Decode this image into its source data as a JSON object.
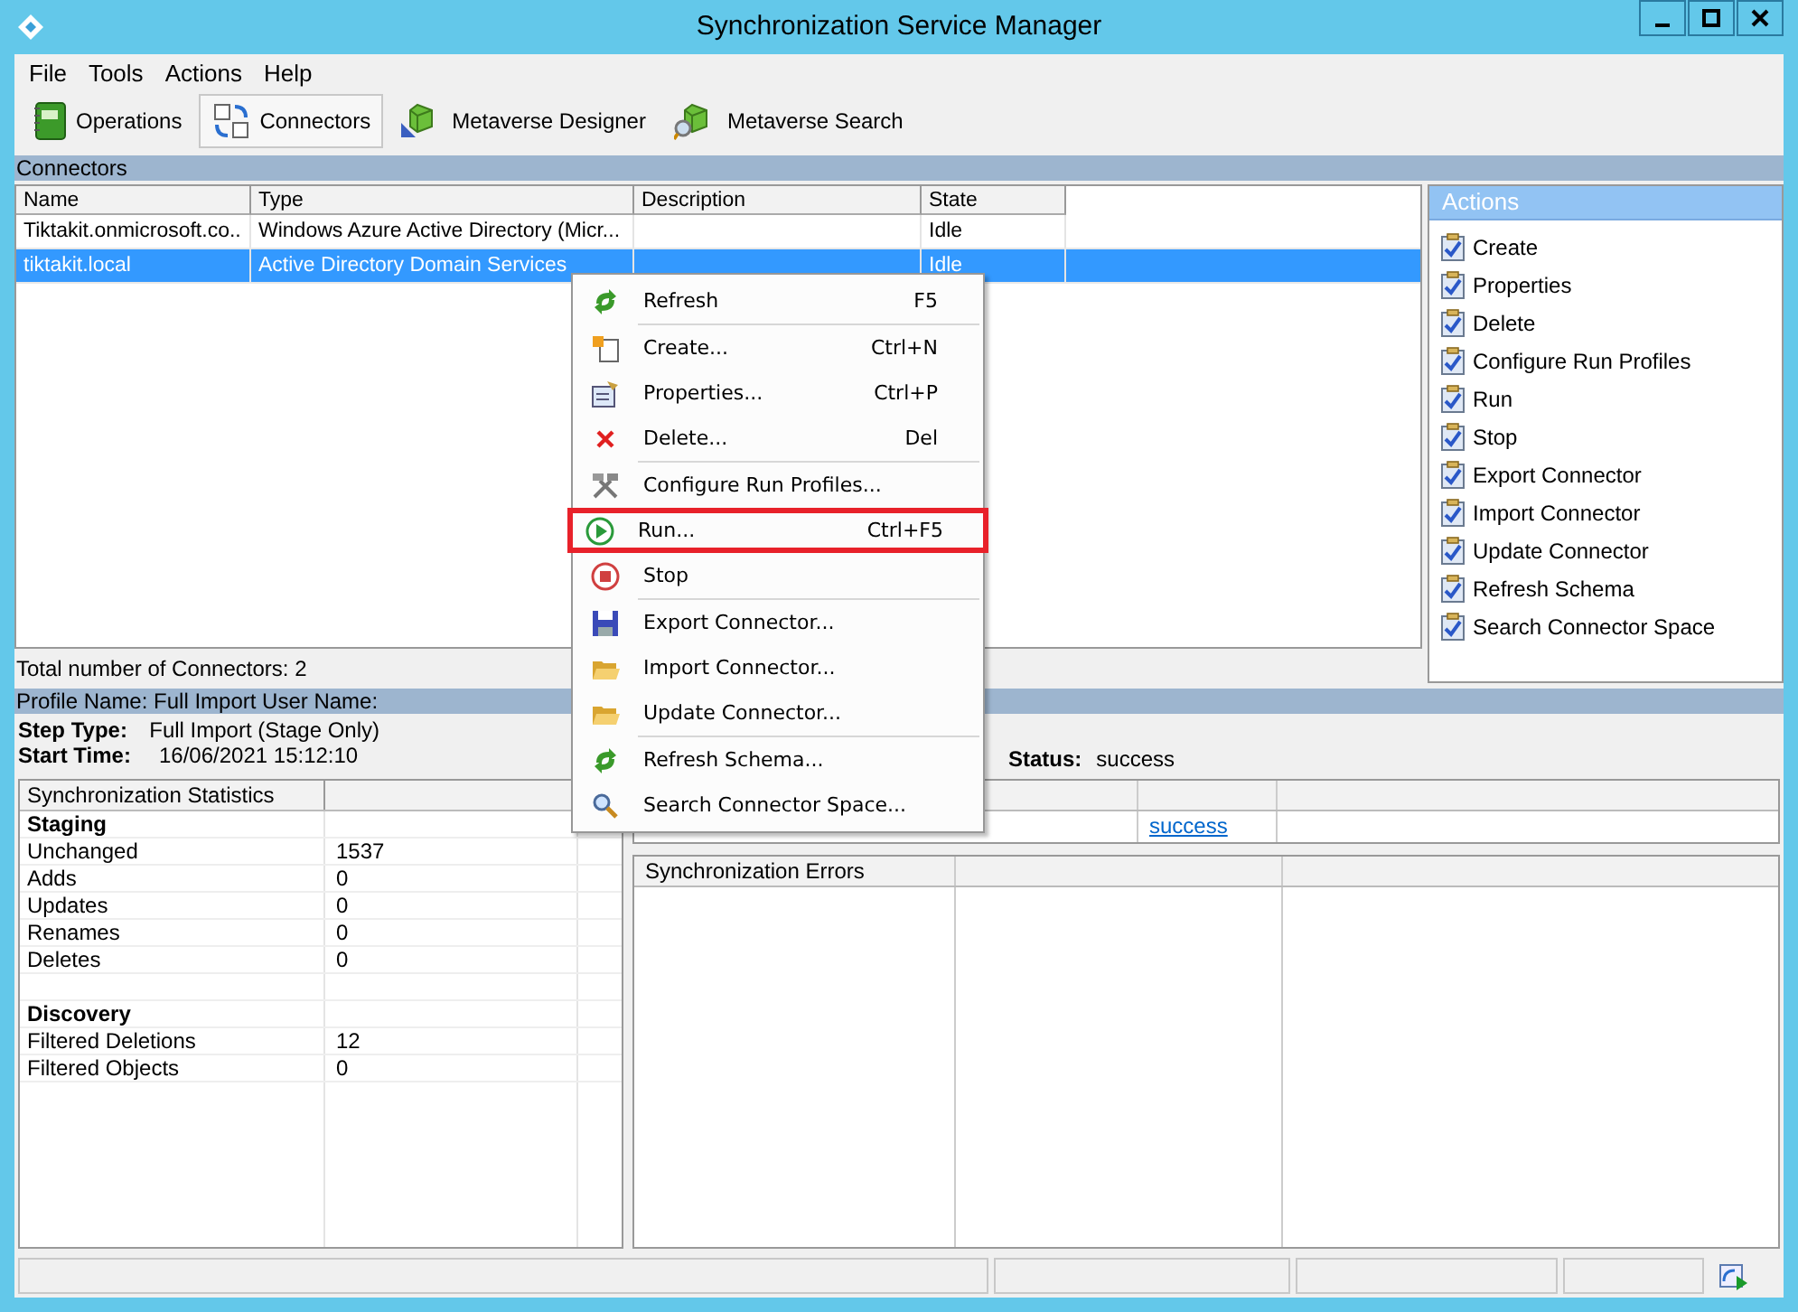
{
  "window": {
    "title": "Synchronization Service Manager"
  },
  "menu_bar": [
    "File",
    "Tools",
    "Actions",
    "Help"
  ],
  "toolbar": [
    {
      "label": "Operations",
      "selected": false
    },
    {
      "label": "Connectors",
      "selected": true
    },
    {
      "label": "Metaverse Designer",
      "selected": false
    },
    {
      "label": "Metaverse Search",
      "selected": false
    }
  ],
  "connectors": {
    "title": "Connectors",
    "columns": [
      "Name",
      "Type",
      "Description",
      "State"
    ],
    "rows": [
      {
        "cells": [
          "Tiktakit.onmicrosoft.co..",
          "Windows Azure Active Directory (Micr...",
          "",
          "Idle"
        ],
        "selected": false
      },
      {
        "cells": [
          "tiktakit.local",
          "Active Directory Domain Services",
          "",
          "Idle"
        ],
        "selected": true
      }
    ],
    "total": "Total number of Connectors: 2"
  },
  "actions": {
    "title": "Actions",
    "items": [
      "Create",
      "Properties",
      "Delete",
      "Configure Run Profiles",
      "Run",
      "Stop",
      "Export Connector",
      "Import Connector",
      "Update Connector",
      "Refresh Schema",
      "Search Connector Space"
    ]
  },
  "context_menu": {
    "groups": [
      [
        {
          "label": "Refresh",
          "shortcut": "F5",
          "highlighted": false
        }
      ],
      [
        {
          "label": "Create...",
          "shortcut": "Ctrl+N",
          "highlighted": false
        },
        {
          "label": "Properties...",
          "shortcut": "Ctrl+P",
          "highlighted": false
        },
        {
          "label": "Delete...",
          "shortcut": "Del",
          "highlighted": false
        }
      ],
      [
        {
          "label": "Configure Run Profiles...",
          "highlighted": false
        },
        {
          "label": "Run...",
          "shortcut": "Ctrl+F5",
          "highlighted": true
        },
        {
          "label": "Stop",
          "highlighted": false
        }
      ],
      [
        {
          "label": "Export Connector...",
          "highlighted": false
        },
        {
          "label": "Import Connector...",
          "highlighted": false
        },
        {
          "label": "Update Connector...",
          "highlighted": false
        }
      ],
      [
        {
          "label": "Refresh Schema...",
          "highlighted": false
        },
        {
          "label": "Search Connector Space...",
          "highlighted": false
        }
      ]
    ]
  },
  "run_details": {
    "header": "Profile Name: Full Import  User Name:",
    "fields": [
      {
        "label": "Step Type:",
        "value": "Full Import (Stage Only)"
      },
      {
        "label": "Start Time:",
        "value": "16/06/2021 15:12:10"
      }
    ],
    "status_label": "Status:",
    "status_value": "success",
    "statistics": {
      "title": "Synchronization Statistics",
      "rows": [
        {
          "kind": "heading",
          "label": "Staging"
        },
        {
          "kind": "row",
          "label": "Unchanged",
          "value": "1537"
        },
        {
          "kind": "row",
          "label": "Adds",
          "value": "0"
        },
        {
          "kind": "row",
          "label": "Updates",
          "value": "0"
        },
        {
          "kind": "row",
          "label": "Renames",
          "value": "0"
        },
        {
          "kind": "row",
          "label": "Deletes",
          "value": "0"
        },
        {
          "kind": "spacer"
        },
        {
          "kind": "heading",
          "label": "Discovery"
        },
        {
          "kind": "row",
          "label": "Filtered Deletions",
          "value": "12"
        },
        {
          "kind": "row",
          "label": "Filtered Objects",
          "value": "0"
        }
      ]
    },
    "connection_link": "success",
    "errors": {
      "title": "Synchronization Errors"
    }
  }
}
